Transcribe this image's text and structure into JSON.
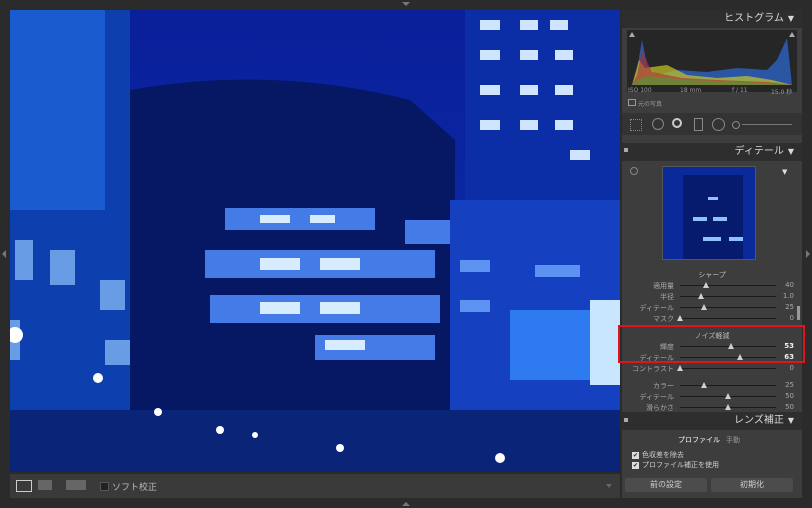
{
  "histogram": {
    "title": "ヒストグラム",
    "exif": [
      "ISO 100",
      "18 mm",
      "f / 11",
      "15.0 秒"
    ],
    "original_photo_label": "元の写真"
  },
  "detail": {
    "title": "ディテール",
    "sharpen": {
      "title": "シャープ",
      "sliders": [
        {
          "label": "適用量",
          "value": "40",
          "pos": 0.27
        },
        {
          "label": "半径",
          "value": "1.0",
          "pos": 0.22
        },
        {
          "label": "ディテール",
          "value": "25",
          "pos": 0.25
        },
        {
          "label": "マスク",
          "value": "0",
          "pos": 0.0
        }
      ]
    },
    "noise": {
      "title": "ノイズ軽減",
      "sliders": [
        {
          "label": "輝度",
          "value": "53",
          "pos": 0.53
        },
        {
          "label": "ディテール",
          "value": "63",
          "pos": 0.63
        },
        {
          "label": "コントラスト",
          "value": "0",
          "pos": 0.0
        }
      ]
    },
    "color": {
      "sliders": [
        {
          "label": "カラー",
          "value": "25",
          "pos": 0.25
        },
        {
          "label": "ディテール",
          "value": "50",
          "pos": 0.5
        },
        {
          "label": "滑らかさ",
          "value": "50",
          "pos": 0.5
        }
      ]
    },
    "highlight_color": "#e0141e"
  },
  "lens": {
    "title": "レンズ補正",
    "tabs": [
      "プロファイル",
      "手動"
    ],
    "checkboxes": [
      "色収差を除去",
      "プロファイル補正を使用"
    ]
  },
  "buttons": {
    "previous": "前の設定",
    "reset": "初期化"
  },
  "toolbar": {
    "soft_proof": "ソフト校正"
  }
}
